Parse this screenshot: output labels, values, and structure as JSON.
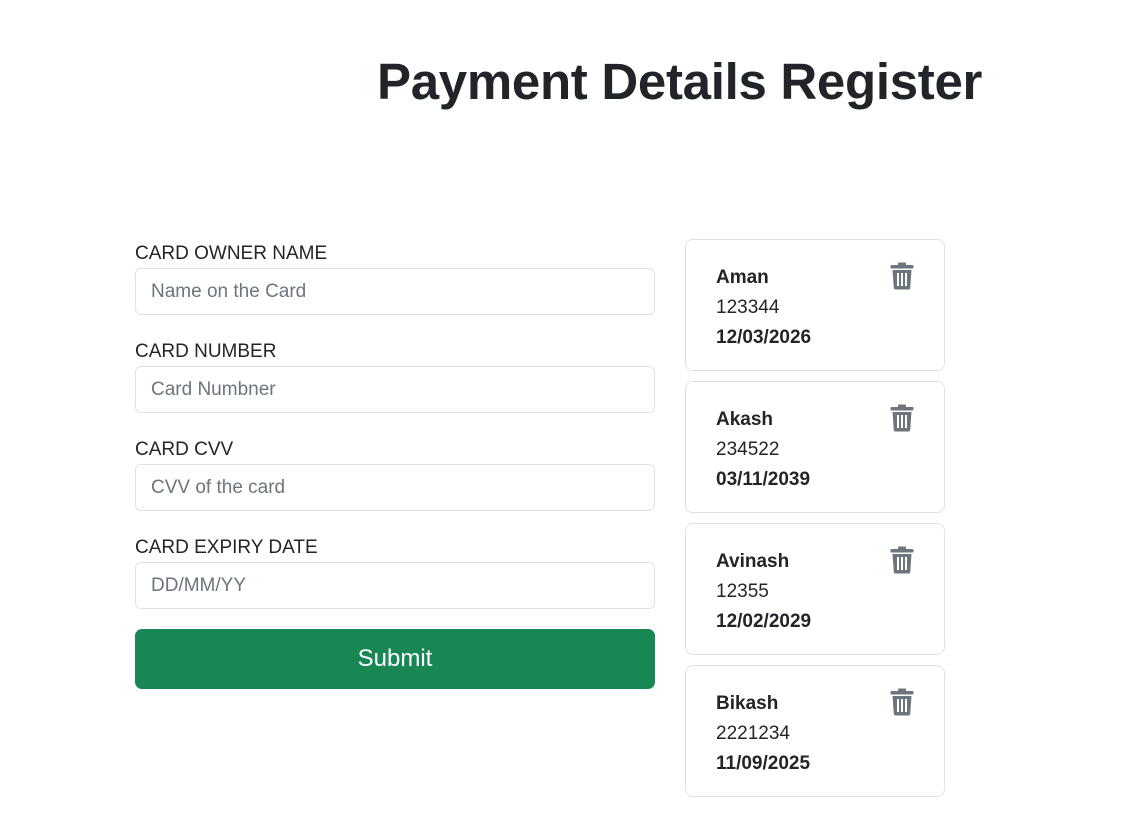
{
  "header": {
    "title": "Payment Details Register"
  },
  "form": {
    "owner_name": {
      "label": "CARD OWNER NAME",
      "placeholder": "Name on the Card",
      "value": ""
    },
    "card_number": {
      "label": "CARD NUMBER",
      "placeholder": "Card Numbner",
      "value": ""
    },
    "cvv": {
      "label": "CARD CVV",
      "placeholder": "CVV of the card",
      "value": ""
    },
    "expiry": {
      "label": "CARD EXPIRY DATE",
      "placeholder": "DD/MM/YY",
      "value": ""
    },
    "submit_label": "Submit"
  },
  "cards": [
    {
      "name": "Aman",
      "number": "123344",
      "expiry": "12/03/2026",
      "icon": "trash-icon"
    },
    {
      "name": "Akash",
      "number": "234522",
      "expiry": "03/11/2039",
      "icon": "trash-icon"
    },
    {
      "name": "Avinash",
      "number": "12355",
      "expiry": "12/02/2029",
      "icon": "trash-icon"
    },
    {
      "name": "Bikash",
      "number": "2221234",
      "expiry": "11/09/2025",
      "icon": "trash-icon"
    }
  ],
  "colors": {
    "primary_text": "#212529",
    "submit_bg": "#198754",
    "border": "#dee2e6",
    "icon": "#6c757d"
  }
}
